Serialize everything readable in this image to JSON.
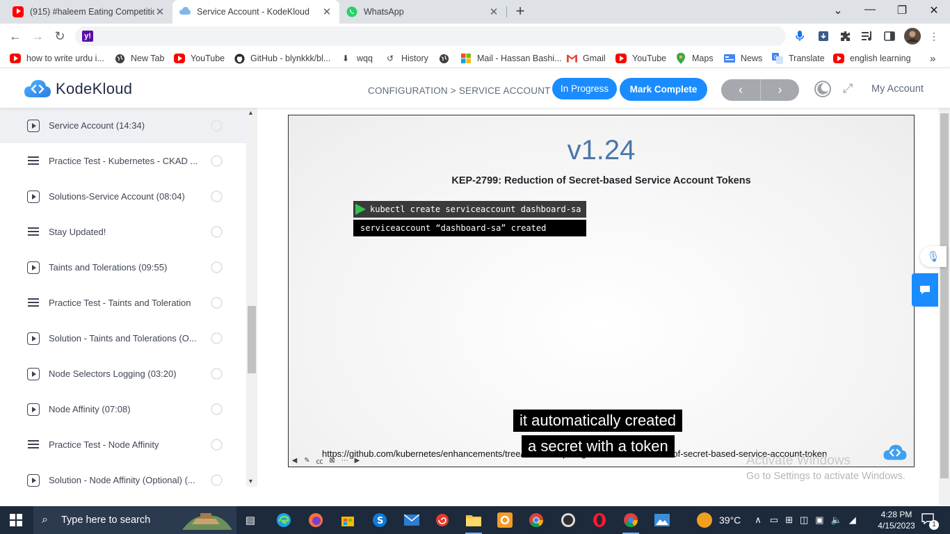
{
  "browser": {
    "tabs": [
      {
        "title": "(915) #haleem Eating Competitio",
        "close": "✕"
      },
      {
        "title": "Service Account - KodeKloud",
        "close": "✕"
      },
      {
        "title": "WhatsApp",
        "close": "✕"
      }
    ],
    "new_tab": "+",
    "window_controls": {
      "dropdown": "⌄",
      "minimize": "—",
      "restore": "❐",
      "close": "✕"
    },
    "nav": {
      "back": "←",
      "forward": "→",
      "reload": "↻"
    },
    "address": ""
  },
  "bookmarks": [
    {
      "label": "how to write urdu i...",
      "icon": "youtube-icon"
    },
    {
      "label": "New Tab",
      "icon": "globe-icon"
    },
    {
      "label": "YouTube",
      "icon": "youtube-icon"
    },
    {
      "label": "GitHub - blynkkk/bl...",
      "icon": "github-icon"
    },
    {
      "label": "wqq",
      "icon": "download-icon"
    },
    {
      "label": "History",
      "icon": "history-icon"
    },
    {
      "label": "",
      "icon": "globe-icon"
    },
    {
      "label": "Mail - Hassan Bashi...",
      "icon": "microsoft-icon"
    },
    {
      "label": "Gmail",
      "icon": "gmail-icon"
    },
    {
      "label": "YouTube",
      "icon": "youtube-icon"
    },
    {
      "label": "Maps",
      "icon": "maps-icon"
    },
    {
      "label": "News",
      "icon": "news-icon"
    },
    {
      "label": "Translate",
      "icon": "translate-icon"
    },
    {
      "label": "english learning",
      "icon": "youtube-icon"
    }
  ],
  "bookmarks_more": "»",
  "header": {
    "logo_text": "KodeKloud",
    "breadcrumb": "CONFIGURATION > SERVICE ACCOUNT",
    "status": "In Progress",
    "mark_complete": "Mark Complete",
    "prev": "‹",
    "next": "›",
    "expand": "⤢",
    "my_account": "My Account"
  },
  "sidebar": {
    "lessons": [
      {
        "type": "video",
        "label": "Service Account (14:34)",
        "active": true
      },
      {
        "type": "list",
        "label": "Practice Test - Kubernetes - CKAD ..."
      },
      {
        "type": "video",
        "label": "Solutions-Service Account (08:04)"
      },
      {
        "type": "list",
        "label": "Stay Updated!"
      },
      {
        "type": "video",
        "label": "Taints and Tolerations (09:55)"
      },
      {
        "type": "list",
        "label": "Practice Test - Taints and Toleration"
      },
      {
        "type": "video",
        "label": "Solution - Taints and Tolerations (O..."
      },
      {
        "type": "video",
        "label": "Node Selectors Logging (03:20)"
      },
      {
        "type": "video",
        "label": "Node Affinity (07:08)"
      },
      {
        "type": "list",
        "label": "Practice Test - Node Affinity"
      },
      {
        "type": "video",
        "label": "Solution - Node Affinity (Optional) (..."
      }
    ]
  },
  "video": {
    "version": "v1.24",
    "kep_title": "KEP-2799: Reduction of Secret-based Service Account Tokens",
    "command": "kubectl create serviceaccount dashboard-sa",
    "command_output": "serviceaccount “dashboard-sa” created",
    "source_url": "https://github.com/kubernetes/enhancements/tree/master/keps/sig-auth/2799-reduction-of-secret-based-service-account-token",
    "caption_line_1": "it automatically created",
    "caption_line_2": "a secret with a token"
  },
  "watermark": {
    "line1": "Activate Windows",
    "line2": "Go to Settings to activate Windows."
  },
  "taskbar": {
    "search_placeholder": "Type here to search",
    "weather": "39°C",
    "time": "4:28 PM",
    "date": "4/15/2023",
    "notification_count": "1"
  },
  "colors": {
    "accent": "#1a8cff",
    "nav_disabled": "#a5a9ad",
    "version_blue": "#4a77a8",
    "taskbar": "#1c2a3c"
  }
}
